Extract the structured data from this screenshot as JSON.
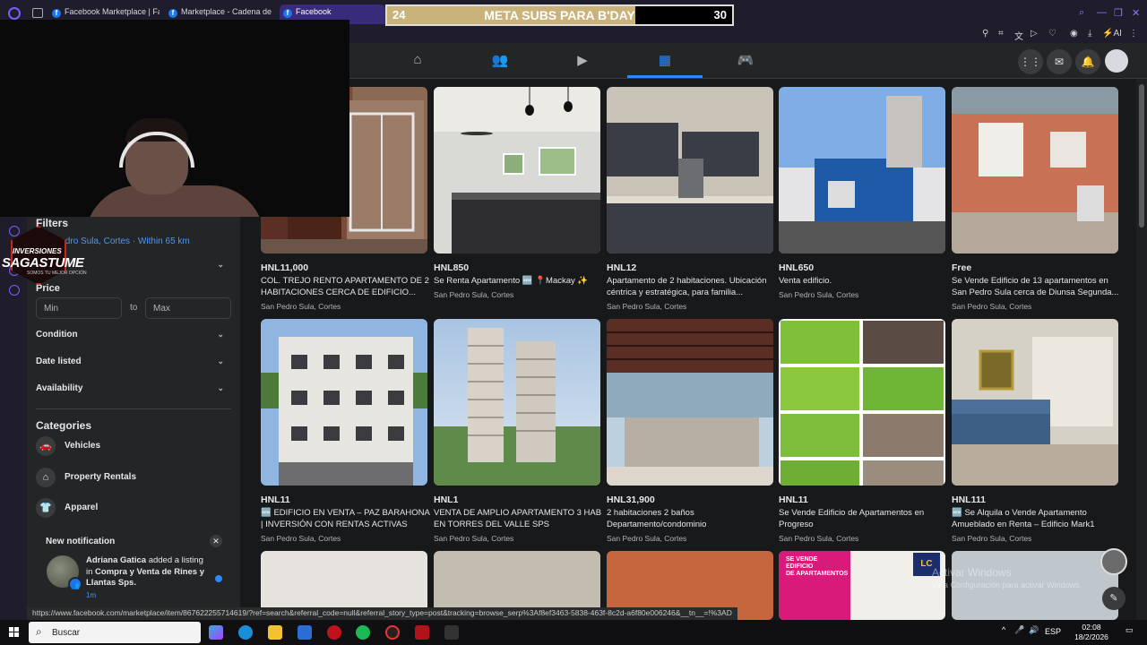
{
  "browser": {
    "tabs": [
      {
        "label": "Facebook Marketplace | Fa",
        "active": false
      },
      {
        "label": "Marketplace - Cadena de",
        "active": false
      },
      {
        "label": "Facebook",
        "active": true
      }
    ]
  },
  "meta_bar": {
    "start": "24",
    "label": "META SUBS PARA B'DAY",
    "end": "30",
    "progress": 0.72
  },
  "sidebar": {
    "filters_heading": "Filters",
    "location": "San Pedro Sula, Cortes · Within 65 km",
    "price_heading": "Price",
    "min_placeholder": "Min",
    "to_label": "to",
    "max_placeholder": "Max",
    "filters": [
      {
        "label": "Condition"
      },
      {
        "label": "Date listed"
      },
      {
        "label": "Availability"
      }
    ],
    "categories_heading": "Categories",
    "categories": [
      {
        "label": "Vehicles",
        "icon": "car-icon"
      },
      {
        "label": "Property Rentals",
        "icon": "house-icon"
      },
      {
        "label": "Apparel",
        "icon": "shirt-icon"
      }
    ]
  },
  "notification": {
    "title": "New notification",
    "user": "Adriana Gatica",
    "action": " added a listing in ",
    "group": "Compra y Venta de Rines y Llantas Sps.",
    "time": "1m"
  },
  "logo": {
    "line1": "INVERSIONES",
    "line2": "SAGASTUME",
    "line3": "SOMOS TU MEJOR OPCIÓN"
  },
  "listings": [
    {
      "price": "HNL11,000",
      "title": "COL. TREJO RENTO APARTAMENTO DE 2 HABITACIONES CERCA DE EDIFICIO...",
      "location": "San Pedro Sula, Cortes"
    },
    {
      "price": "HNL850",
      "title": "Se Renta Apartamento 🆕 📍Mackay ✨",
      "location": "San Pedro Sula, Cortes"
    },
    {
      "price": "HNL12",
      "title": "Apartamento de 2 habitaciones. Ubicación céntrica y estratégica, para familia...",
      "location": "San Pedro Sula, Cortes"
    },
    {
      "price": "HNL650",
      "title": "Venta edificio.",
      "location": "San Pedro Sula, Cortes"
    },
    {
      "price": "Free",
      "title": "Se Vende Edificio de 13 apartamentos en San Pedro Sula cerca de Diunsa Segunda...",
      "location": "San Pedro Sula, Cortes"
    },
    {
      "price": "HNL11",
      "title": "🆕 EDIFICIO EN VENTA – PAZ BARAHONA | INVERSIÓN CON RENTAS ACTIVAS",
      "location": "San Pedro Sula, Cortes"
    },
    {
      "price": "HNL1",
      "title": "VENTA DE AMPLIO APARTAMENTO 3 HAB EN TORRES DEL VALLE SPS",
      "location": "San Pedro Sula, Cortes"
    },
    {
      "price": "HNL31,900",
      "title": "2 habitaciones 2 baños Departamento/condominio",
      "location": "San Pedro Sula, Cortes"
    },
    {
      "price": "HNL11",
      "title": "Se Vende Edificio de Apartamentos en Progreso",
      "location": "San Pedro Sula, Cortes"
    },
    {
      "price": "HNL111",
      "title": "🆕 Se Alquila o Vende Apartamento Amueblado en Renta – Edificio Mark1",
      "location": "San Pedro Sula, Cortes"
    }
  ],
  "third_row_banner": {
    "line1": "SE VENDE",
    "line2": "EDIFICIO",
    "line3": "DE APARTAMENTOS",
    "badge": "LC"
  },
  "status_url": "https://www.facebook.com/marketplace/item/867622255714619/?ref=search&referral_code=null&referral_story_type=post&tracking=browse_serp%3Af8ef3463-5838-463f-8c2d-a6f80e006246&__tn__=!%3AD",
  "activate_windows": {
    "line1": "Activar Windows",
    "line2": "Ve a Configuración para activar Windows."
  },
  "taskbar": {
    "search_label": "Buscar",
    "language": "ESP",
    "time": "02:08",
    "date": "18/2/2026"
  },
  "colors": {
    "accent": "#2d88ff",
    "background": "#18191a",
    "panel": "#242526",
    "meta_fill": "#c9b37b"
  }
}
